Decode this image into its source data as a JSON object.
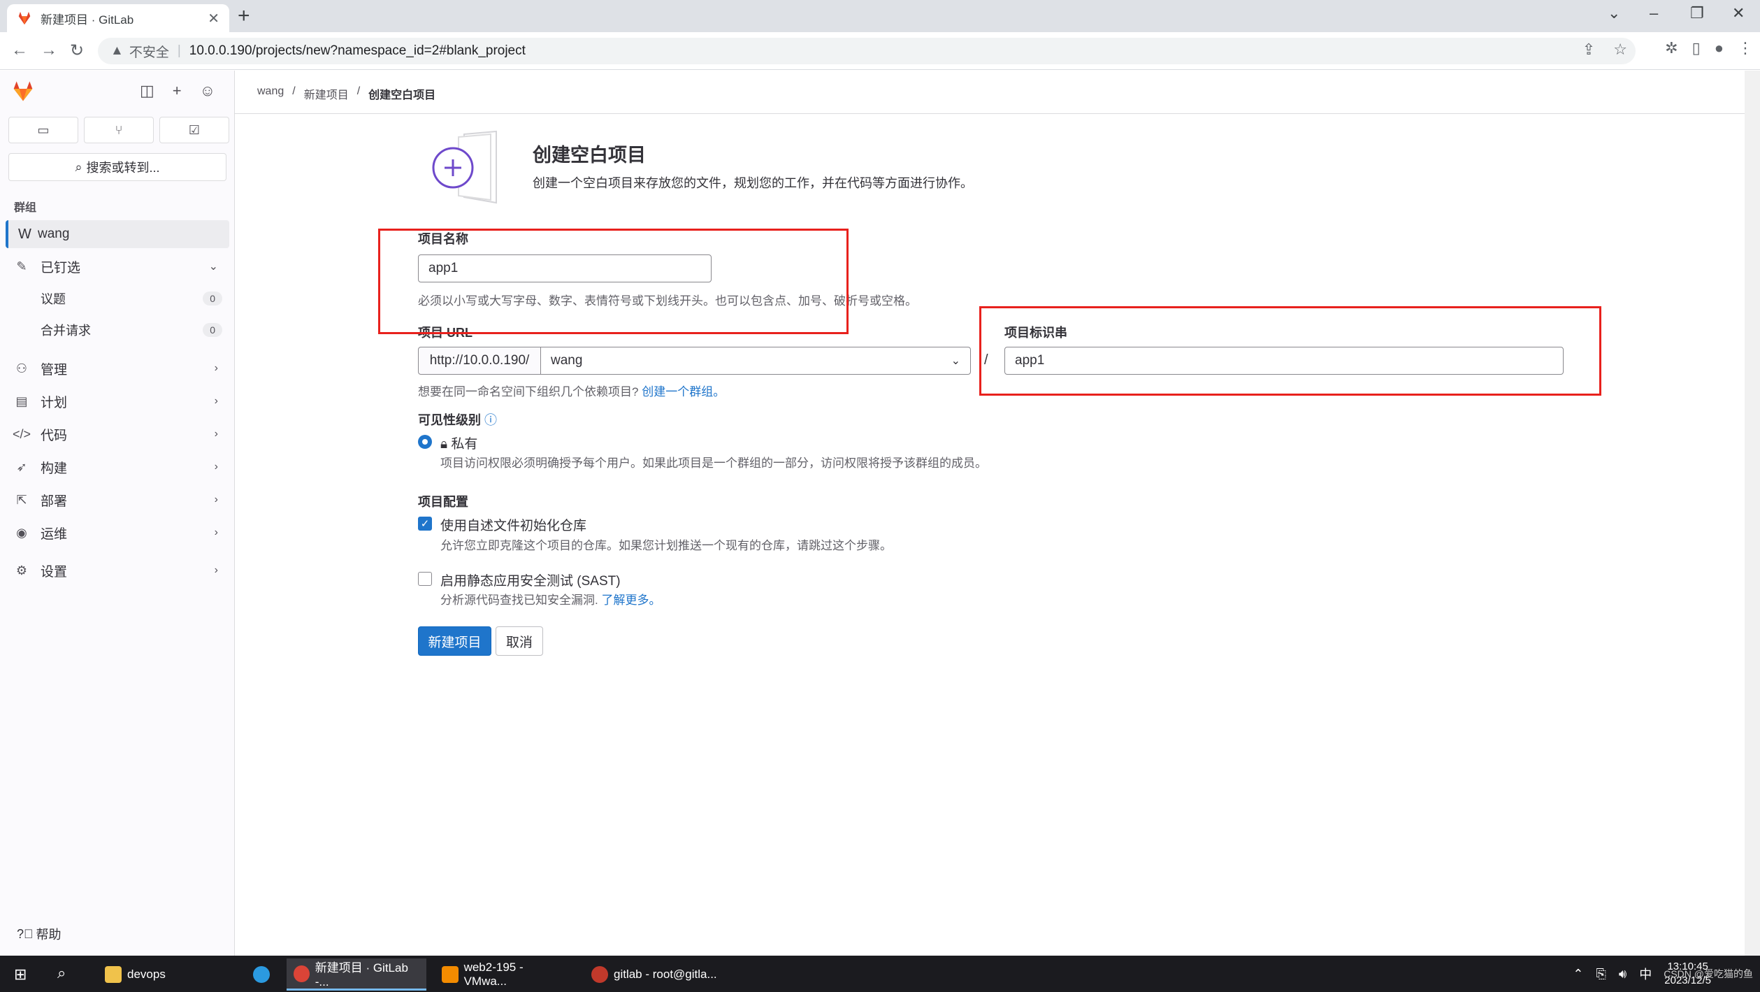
{
  "browser": {
    "tab_title": "新建项目 · GitLab",
    "insecure_label": "不安全",
    "url": "10.0.0.190/projects/new?namespace_id=2#blank_project"
  },
  "sidebar": {
    "search_label": "搜索或转到...",
    "section_label": "群组",
    "group": {
      "initial": "W",
      "name": "wang"
    },
    "pinned_label": "已钉选",
    "pinned_items": [
      {
        "label": "议题",
        "count": "0"
      },
      {
        "label": "合并请求",
        "count": "0"
      }
    ],
    "nav_items": [
      {
        "label": "管理",
        "icon": "users-icon"
      },
      {
        "label": "计划",
        "icon": "calendar-icon"
      },
      {
        "label": "代码",
        "icon": "code-icon"
      },
      {
        "label": "构建",
        "icon": "rocket-icon"
      },
      {
        "label": "部署",
        "icon": "deploy-icon"
      },
      {
        "label": "运维",
        "icon": "monitor-icon"
      },
      {
        "label": "设置",
        "icon": "gear-icon"
      }
    ],
    "help_label": "帮助"
  },
  "breadcrumb": {
    "items": [
      "wang",
      "新建项目"
    ],
    "current": "创建空白项目"
  },
  "header": {
    "title": "创建空白项目",
    "description": "创建一个空白项目来存放您的文件，规划您的工作，并在代码等方面进行协作。"
  },
  "form": {
    "project_name_label": "项目名称",
    "project_name_value": "app1",
    "project_name_help": "必须以小写或大写字母、数字、表情符号或下划线开头。也可以包含点、加号、破折号或空格。",
    "project_url_label": "项目 URL",
    "project_url_prefix": "http://10.0.0.190/",
    "namespace_value": "wang",
    "slug_label": "项目标识串",
    "slug_value": "app1",
    "url_help_text": "想要在同一命名空间下组织几个依赖项目?",
    "url_help_link": "创建一个群组。",
    "visibility_label": "可见性级别",
    "visibility_option": "私有",
    "visibility_help": "项目访问权限必须明确授予每个用户。如果此项目是一个群组的一部分，访问权限将授予该群组的成员。",
    "config_label": "项目配置",
    "readme_label": "使用自述文件初始化仓库",
    "readme_checked": true,
    "readme_help": "允许您立即克隆这个项目的仓库。如果您计划推送一个现有的仓库，请跳过这个步骤。",
    "sast_label": "启用静态应用安全测试 (SAST)",
    "sast_checked": false,
    "sast_help_text": "分析源代码查找已知安全漏洞.",
    "sast_help_link": "了解更多。",
    "submit_label": "新建项目",
    "cancel_label": "取消"
  },
  "taskbar": {
    "apps": [
      {
        "label": "devops"
      },
      {
        "label": "新建项目 · GitLab -..."
      },
      {
        "label": "web2-195 - VMwa..."
      },
      {
        "label": "gitlab - root@gitla..."
      }
    ],
    "ime": "中",
    "time": "13:10:45",
    "date": "2023/12/5",
    "watermark": "CSDN @爱吃猫的鱼"
  },
  "colors": {
    "accent": "#1f75cb",
    "annotation_red": "#e8211d",
    "brand_orange": "#e24329"
  }
}
